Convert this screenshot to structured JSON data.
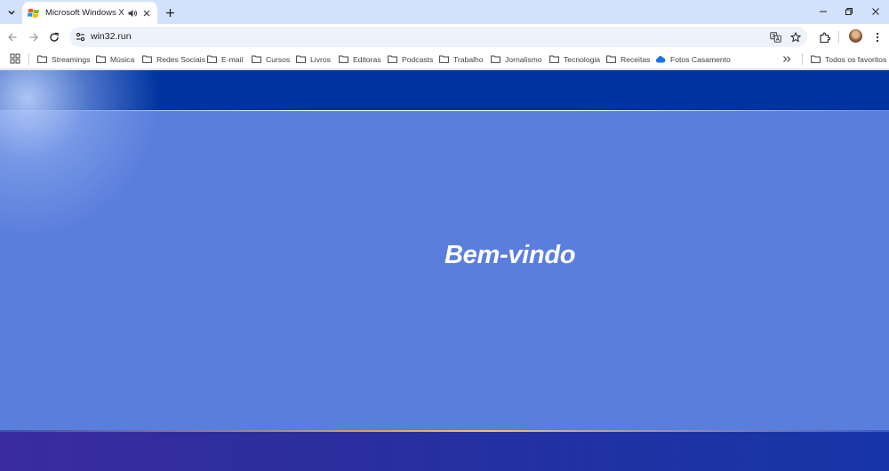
{
  "tab": {
    "title": "Microsoft Windows XP Prof"
  },
  "address": {
    "url": "win32.run"
  },
  "bookmarks": {
    "items": [
      {
        "label": "Streamings",
        "icon": "folder-icon"
      },
      {
        "label": "Música",
        "icon": "folder-icon"
      },
      {
        "label": "Redes Sociais",
        "icon": "folder-icon"
      },
      {
        "label": "E-mail",
        "icon": "folder-icon"
      },
      {
        "label": "Cursos",
        "icon": "folder-icon"
      },
      {
        "label": "Livros",
        "icon": "folder-icon"
      },
      {
        "label": "Editoras",
        "icon": "folder-icon"
      },
      {
        "label": "Podcasts",
        "icon": "folder-icon"
      },
      {
        "label": "Trabalho",
        "icon": "folder-icon"
      },
      {
        "label": "Jornalismo",
        "icon": "folder-icon"
      },
      {
        "label": "Tecnologia",
        "icon": "folder-icon"
      },
      {
        "label": "Receitas",
        "icon": "folder-icon"
      },
      {
        "label": "Fotos Casamento",
        "icon": "cloud-icon"
      }
    ],
    "all_label": "Todos os favoritos"
  },
  "page": {
    "welcome": "Bem-vindo"
  },
  "colors": {
    "header_blue": "#0034a0",
    "page_blue": "#5a7edc",
    "footer_blue": "#2a2e9e"
  }
}
